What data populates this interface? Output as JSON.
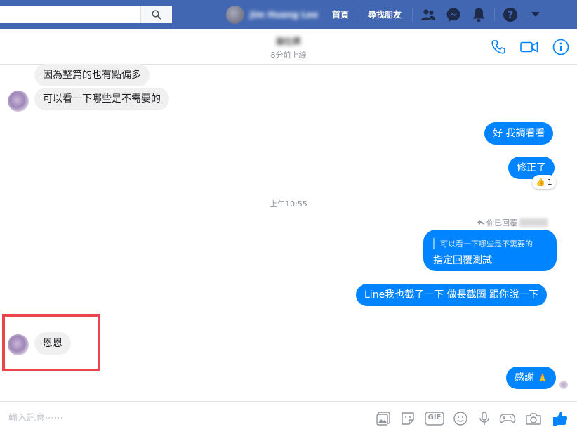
{
  "topbar": {
    "profile_name": "Jim Huang Lee",
    "home": "首頁",
    "find_friends": "尋找朋友"
  },
  "header": {
    "name": "翁仕昇",
    "status": "8分前上線"
  },
  "messages": {
    "in_1": "因為整篇的也有點偏多",
    "in_2": "可以看一下哪些是不需要的",
    "out_1": "好 我調看看",
    "out_2": "修正了",
    "reaction_emoji": "👍",
    "reaction_count": "1",
    "time_divider": "上午10:55",
    "reply_label": "你已回覆",
    "reply_quote": "可以看一下哪些是不需要的",
    "reply_text": "指定回覆測試",
    "out_3": "Line我也截了一下 做長截圖 跟你說一下",
    "in_3": "恩恩",
    "out_4": "感謝",
    "out_4_emoji": "🙏"
  },
  "composer": {
    "placeholder": "輸入訊息⋯⋯",
    "gif": "GIF"
  },
  "colors": {
    "topbar": "#4267b2",
    "accent": "#0084ff",
    "incoming": "#f1f0f0",
    "highlight": "#e8464b"
  }
}
